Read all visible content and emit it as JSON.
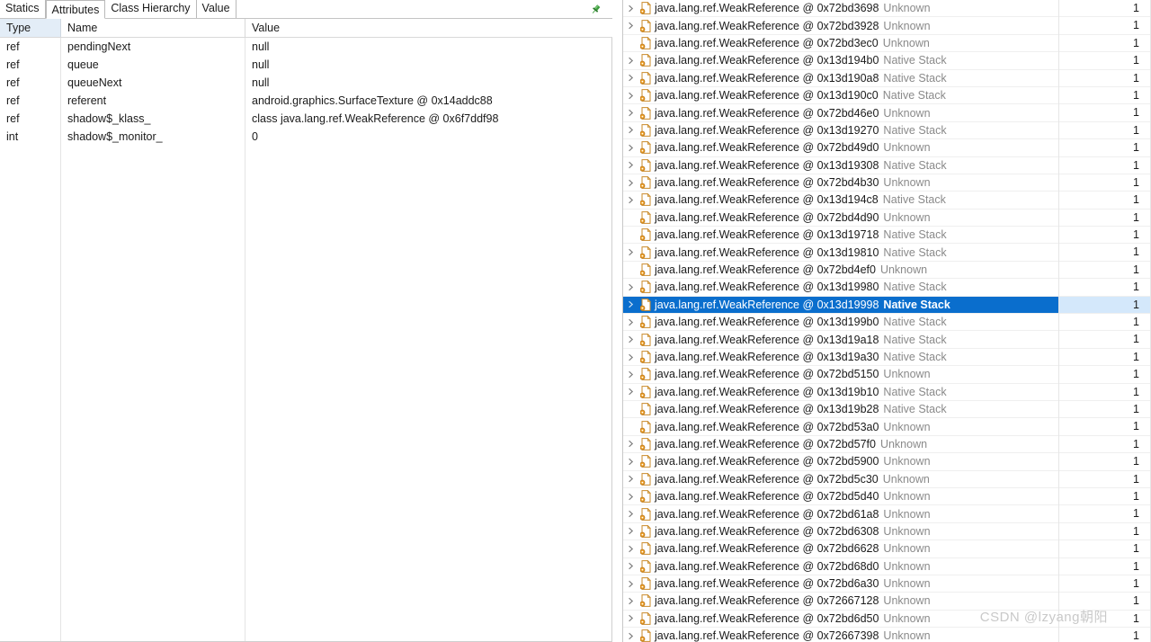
{
  "left_panel": {
    "tabs": [
      {
        "label": "Statics",
        "active": false
      },
      {
        "label": "Attributes",
        "active": true
      },
      {
        "label": "Class Hierarchy",
        "active": false
      },
      {
        "label": "Value",
        "active": false
      }
    ],
    "pin_icon": "pin-icon",
    "table": {
      "columns": [
        "Type",
        "Name",
        "Value"
      ],
      "rows": [
        {
          "type": "ref",
          "name": "pendingNext",
          "value": "null"
        },
        {
          "type": "ref",
          "name": "queue",
          "value": "null"
        },
        {
          "type": "ref",
          "name": "queueNext",
          "value": "null"
        },
        {
          "type": "ref",
          "name": "referent",
          "value": "android.graphics.SurfaceTexture @ 0x14addc88"
        },
        {
          "type": "ref",
          "name": "shadow$_klass_",
          "value": "class java.lang.ref.WeakReference @ 0x6f7ddf98"
        },
        {
          "type": "int",
          "name": "shadow$_monitor_",
          "value": "0"
        }
      ]
    }
  },
  "right_panel": {
    "icon_name": "instance-file-icon",
    "rows": [
      {
        "expandable": true,
        "name": "java.lang.ref.WeakReference @ 0x72bd3698",
        "kind": "Unknown",
        "count": "1",
        "selected": false
      },
      {
        "expandable": true,
        "name": "java.lang.ref.WeakReference @ 0x72bd3928",
        "kind": "Unknown",
        "count": "1",
        "selected": false
      },
      {
        "expandable": false,
        "name": "java.lang.ref.WeakReference @ 0x72bd3ec0",
        "kind": "Unknown",
        "count": "1",
        "selected": false
      },
      {
        "expandable": true,
        "name": "java.lang.ref.WeakReference @ 0x13d194b0",
        "kind": "Native Stack",
        "count": "1",
        "selected": false
      },
      {
        "expandable": true,
        "name": "java.lang.ref.WeakReference @ 0x13d190a8",
        "kind": "Native Stack",
        "count": "1",
        "selected": false
      },
      {
        "expandable": true,
        "name": "java.lang.ref.WeakReference @ 0x13d190c0",
        "kind": "Native Stack",
        "count": "1",
        "selected": false
      },
      {
        "expandable": true,
        "name": "java.lang.ref.WeakReference @ 0x72bd46e0",
        "kind": "Unknown",
        "count": "1",
        "selected": false
      },
      {
        "expandable": true,
        "name": "java.lang.ref.WeakReference @ 0x13d19270",
        "kind": "Native Stack",
        "count": "1",
        "selected": false
      },
      {
        "expandable": true,
        "name": "java.lang.ref.WeakReference @ 0x72bd49d0",
        "kind": "Unknown",
        "count": "1",
        "selected": false
      },
      {
        "expandable": true,
        "name": "java.lang.ref.WeakReference @ 0x13d19308",
        "kind": "Native Stack",
        "count": "1",
        "selected": false
      },
      {
        "expandable": true,
        "name": "java.lang.ref.WeakReference @ 0x72bd4b30",
        "kind": "Unknown",
        "count": "1",
        "selected": false
      },
      {
        "expandable": true,
        "name": "java.lang.ref.WeakReference @ 0x13d194c8",
        "kind": "Native Stack",
        "count": "1",
        "selected": false
      },
      {
        "expandable": false,
        "name": "java.lang.ref.WeakReference @ 0x72bd4d90",
        "kind": "Unknown",
        "count": "1",
        "selected": false
      },
      {
        "expandable": false,
        "name": "java.lang.ref.WeakReference @ 0x13d19718",
        "kind": "Native Stack",
        "count": "1",
        "selected": false
      },
      {
        "expandable": true,
        "name": "java.lang.ref.WeakReference @ 0x13d19810",
        "kind": "Native Stack",
        "count": "1",
        "selected": false
      },
      {
        "expandable": false,
        "name": "java.lang.ref.WeakReference @ 0x72bd4ef0",
        "kind": "Unknown",
        "count": "1",
        "selected": false
      },
      {
        "expandable": true,
        "name": "java.lang.ref.WeakReference @ 0x13d19980",
        "kind": "Native Stack",
        "count": "1",
        "selected": false
      },
      {
        "expandable": true,
        "name": "java.lang.ref.WeakReference @ 0x13d19998",
        "kind": "Native Stack",
        "count": "1",
        "selected": true
      },
      {
        "expandable": true,
        "name": "java.lang.ref.WeakReference @ 0x13d199b0",
        "kind": "Native Stack",
        "count": "1",
        "selected": false
      },
      {
        "expandable": true,
        "name": "java.lang.ref.WeakReference @ 0x13d19a18",
        "kind": "Native Stack",
        "count": "1",
        "selected": false
      },
      {
        "expandable": true,
        "name": "java.lang.ref.WeakReference @ 0x13d19a30",
        "kind": "Native Stack",
        "count": "1",
        "selected": false
      },
      {
        "expandable": true,
        "name": "java.lang.ref.WeakReference @ 0x72bd5150",
        "kind": "Unknown",
        "count": "1",
        "selected": false
      },
      {
        "expandable": true,
        "name": "java.lang.ref.WeakReference @ 0x13d19b10",
        "kind": "Native Stack",
        "count": "1",
        "selected": false
      },
      {
        "expandable": false,
        "name": "java.lang.ref.WeakReference @ 0x13d19b28",
        "kind": "Native Stack",
        "count": "1",
        "selected": false
      },
      {
        "expandable": false,
        "name": "java.lang.ref.WeakReference @ 0x72bd53a0",
        "kind": "Unknown",
        "count": "1",
        "selected": false
      },
      {
        "expandable": true,
        "name": "java.lang.ref.WeakReference @ 0x72bd57f0",
        "kind": "Unknown",
        "count": "1",
        "selected": false
      },
      {
        "expandable": true,
        "name": "java.lang.ref.WeakReference @ 0x72bd5900",
        "kind": "Unknown",
        "count": "1",
        "selected": false
      },
      {
        "expandable": true,
        "name": "java.lang.ref.WeakReference @ 0x72bd5c30",
        "kind": "Unknown",
        "count": "1",
        "selected": false
      },
      {
        "expandable": true,
        "name": "java.lang.ref.WeakReference @ 0x72bd5d40",
        "kind": "Unknown",
        "count": "1",
        "selected": false
      },
      {
        "expandable": true,
        "name": "java.lang.ref.WeakReference @ 0x72bd61a8",
        "kind": "Unknown",
        "count": "1",
        "selected": false
      },
      {
        "expandable": true,
        "name": "java.lang.ref.WeakReference @ 0x72bd6308",
        "kind": "Unknown",
        "count": "1",
        "selected": false
      },
      {
        "expandable": true,
        "name": "java.lang.ref.WeakReference @ 0x72bd6628",
        "kind": "Unknown",
        "count": "1",
        "selected": false
      },
      {
        "expandable": true,
        "name": "java.lang.ref.WeakReference @ 0x72bd68d0",
        "kind": "Unknown",
        "count": "1",
        "selected": false
      },
      {
        "expandable": true,
        "name": "java.lang.ref.WeakReference @ 0x72bd6a30",
        "kind": "Unknown",
        "count": "1",
        "selected": false
      },
      {
        "expandable": true,
        "name": "java.lang.ref.WeakReference @ 0x72667128",
        "kind": "Unknown",
        "count": "1",
        "selected": false
      },
      {
        "expandable": true,
        "name": "java.lang.ref.WeakReference @ 0x72bd6d50",
        "kind": "Unknown",
        "count": "1",
        "selected": false
      },
      {
        "expandable": true,
        "name": "java.lang.ref.WeakReference @ 0x72667398",
        "kind": "Unknown",
        "count": "1",
        "selected": false
      }
    ]
  },
  "watermark": {
    "text": "CSDN @lzyang朝阳"
  },
  "colors": {
    "selection_blue": "#0a6ecd",
    "selection_row_tint": "#d4e8fb",
    "header_tint": "#e3edf7",
    "kind_gray": "#8a8a8a",
    "icon_orange": "#e8932a"
  }
}
